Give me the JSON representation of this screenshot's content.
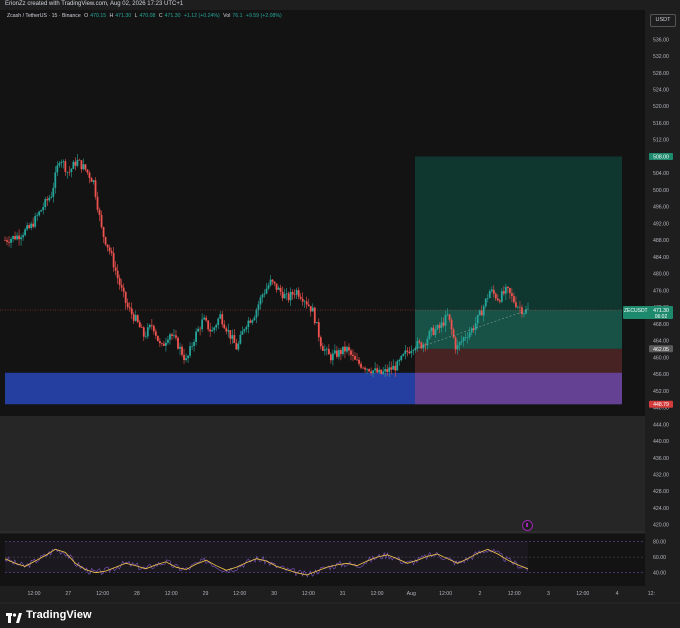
{
  "header": {
    "credit": "ErionZz created with TradingView.com, Aug 02, 2026 17:23 UTC+1"
  },
  "legend": {
    "symbol": "Zcash / TetherUS · 15 · Binance",
    "o_label": "O",
    "o": "470.15",
    "h_label": "H",
    "h": "471.30",
    "l_label": "L",
    "l": "470.08",
    "c_label": "C",
    "c": "471.30",
    "change": "+1.12 (+0.24%)",
    "vol_label": "Vol",
    "vol": "76.1",
    "vol_change": "+9.59 (+2.08%)"
  },
  "currency_badge": "USDT",
  "footer": {
    "brand": "TradingView"
  },
  "colors": {
    "background": "#131313",
    "up": "#26a69a",
    "down": "#ef5350",
    "demand_zone": "#2641a8",
    "target_zone": "#0f3b33",
    "stop_zone": "#5a2a2a",
    "rsi_line": "#7e57c2",
    "rsi_ma": "#f7c948"
  },
  "chart_data": {
    "type": "candlestick",
    "y_ticks": [
      420,
      424,
      428,
      432,
      436,
      440,
      444,
      448,
      452,
      456,
      460,
      464,
      468,
      472,
      476,
      480,
      484,
      488,
      492,
      496,
      500,
      504,
      508,
      512,
      516,
      520,
      524,
      528,
      532,
      536,
      540
    ],
    "y_tick_labels": [
      "420.00",
      "424.00",
      "428.00",
      "432.00",
      "436.00",
      "440.00",
      "444.00",
      "448.00",
      "452.00",
      "456.00",
      "460.00",
      "464.00",
      "468.00",
      "472.00",
      "476.00",
      "480.00",
      "484.00",
      "488.00",
      "492.00",
      "496.00",
      "500.00",
      "504.00",
      "508.00",
      "512.00",
      "516.00",
      "520.00",
      "524.00",
      "528.00",
      "532.00",
      "536.00",
      "540.00"
    ],
    "ylim": [
      418.5,
      543
    ],
    "x_ticks": [
      "12:00",
      "27",
      "12:00",
      "28",
      "12:00",
      "29",
      "12:00",
      "30",
      "12:00",
      "31",
      "12:00",
      "Aug",
      "12:00",
      "2",
      "12:00",
      "3",
      "12:00",
      "4",
      "12:"
    ],
    "price_path": [
      [
        0,
        488
      ],
      [
        3,
        489
      ],
      [
        6,
        491
      ],
      [
        9,
        496
      ],
      [
        11,
        499
      ],
      [
        13,
        508
      ],
      [
        15,
        504
      ],
      [
        17,
        507
      ],
      [
        19,
        505
      ],
      [
        21,
        502
      ],
      [
        23,
        490
      ],
      [
        25,
        485
      ],
      [
        27,
        478
      ],
      [
        29,
        472
      ],
      [
        31,
        469
      ],
      [
        33,
        465
      ],
      [
        35,
        468
      ],
      [
        37,
        462
      ],
      [
        39,
        466
      ],
      [
        41,
        463
      ],
      [
        43,
        459
      ],
      [
        45,
        465
      ],
      [
        47,
        469
      ],
      [
        49,
        466
      ],
      [
        51,
        470
      ],
      [
        53,
        466
      ],
      [
        55,
        462
      ],
      [
        57,
        468
      ],
      [
        59,
        470
      ],
      [
        61,
        475
      ],
      [
        63,
        478
      ],
      [
        65,
        476
      ],
      [
        67,
        474
      ],
      [
        69,
        476
      ],
      [
        71,
        474
      ],
      [
        73,
        471
      ],
      [
        75,
        463
      ],
      [
        77,
        460
      ],
      [
        79,
        461
      ],
      [
        81,
        462
      ],
      [
        83,
        459
      ],
      [
        85,
        458
      ],
      [
        87,
        457
      ],
      [
        89,
        456
      ],
      [
        91,
        457
      ],
      [
        93,
        458
      ],
      [
        95,
        461
      ],
      [
        97,
        463
      ],
      [
        99,
        463
      ],
      [
        101,
        466
      ],
      [
        103,
        467
      ],
      [
        105,
        470
      ],
      [
        107,
        462
      ],
      [
        109,
        465
      ],
      [
        111,
        467
      ],
      [
        113,
        471
      ],
      [
        115,
        476
      ],
      [
        117,
        474
      ],
      [
        119,
        476
      ],
      [
        121,
        473
      ],
      [
        123,
        471
      ],
      [
        124,
        471.3
      ]
    ],
    "last_price": {
      "symbol": "ZECUSDT",
      "value": "471.30",
      "countdown": "06:02"
    },
    "position": {
      "type": "long",
      "target": 508.0,
      "target_label": "508.00",
      "entry": 462.05,
      "entry_label": "462.05",
      "stop": 448.79,
      "stop_label": "448.79"
    },
    "demand_zone": {
      "from": 448.79,
      "to": 456.3
    },
    "rsi": {
      "levels": [
        80,
        60,
        40
      ],
      "level_labels": [
        "80.00",
        "60.00",
        "40.00"
      ],
      "ylim": [
        28,
        82
      ],
      "values": [
        58,
        52,
        48,
        55,
        62,
        70,
        66,
        52,
        44,
        40,
        42,
        47,
        52,
        49,
        45,
        50,
        54,
        47,
        44,
        51,
        56,
        49,
        43,
        47,
        53,
        58,
        55,
        48,
        44,
        40,
        37,
        42,
        47,
        50,
        52,
        49,
        55,
        60,
        63,
        58,
        52,
        56,
        61,
        64,
        58,
        52,
        58,
        65,
        70,
        64,
        56,
        50,
        45
      ]
    }
  }
}
